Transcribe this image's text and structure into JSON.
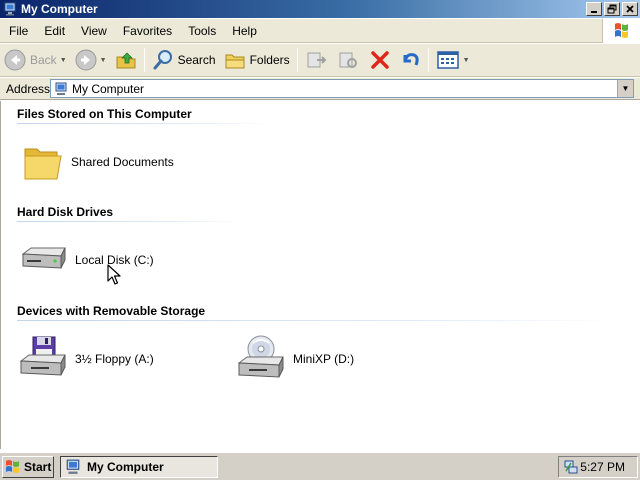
{
  "window": {
    "title": "My Computer"
  },
  "window_controls": {
    "minimize": "_",
    "maximize": "▫",
    "close": "×"
  },
  "menu": [
    "File",
    "Edit",
    "View",
    "Favorites",
    "Tools",
    "Help"
  ],
  "toolbar": {
    "back_label": "Back",
    "search_label": "Search",
    "folders_label": "Folders"
  },
  "address": {
    "label": "Address",
    "value": "My Computer"
  },
  "groups": [
    {
      "header": "Files Stored on This Computer",
      "items": [
        {
          "label": "Shared Documents",
          "icon": "folder-icon"
        }
      ]
    },
    {
      "header": "Hard Disk Drives",
      "items": [
        {
          "label": "Local Disk (C:)",
          "icon": "hard-disk-icon"
        }
      ]
    },
    {
      "header": "Devices with Removable Storage",
      "items": [
        {
          "label": "3½ Floppy (A:)",
          "icon": "floppy-drive-icon"
        },
        {
          "label": "MiniXP (D:)",
          "icon": "cd-drive-icon"
        }
      ]
    }
  ],
  "taskbar": {
    "start_label": "Start",
    "task_label": "My Computer",
    "clock": "5:27 PM"
  },
  "colors": {
    "title_start": "#0a246a",
    "title_end": "#a6caf0",
    "chrome": "#ece9d8",
    "taskbar": "#d4d0c8"
  }
}
